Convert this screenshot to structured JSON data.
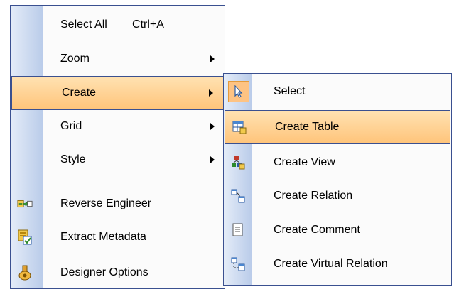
{
  "main_menu": {
    "items": [
      {
        "label": "Select All",
        "shortcut": "Ctrl+A"
      },
      {
        "label": "Zoom"
      },
      {
        "label": "Create"
      },
      {
        "label": "Grid"
      },
      {
        "label": "Style"
      },
      {
        "label": "Reverse Engineer",
        "icon": "reverse-engineer-icon"
      },
      {
        "label": "Extract Metadata",
        "icon": "extract-metadata-icon"
      },
      {
        "label": "Designer Options",
        "icon": "designer-options-icon"
      }
    ]
  },
  "sub_menu": {
    "items": [
      {
        "label": "Select",
        "icon": "cursor-arrow-icon"
      },
      {
        "label": "Create Table",
        "icon": "table-icon"
      },
      {
        "label": "Create View",
        "icon": "view-icon"
      },
      {
        "label": "Create Relation",
        "icon": "relation-icon"
      },
      {
        "label": "Create Comment",
        "icon": "comment-icon"
      },
      {
        "label": "Create Virtual Relation",
        "icon": "virtual-relation-icon"
      }
    ]
  },
  "colors": {
    "border": "#3a5090",
    "highlight_top": "#ffe2b2",
    "highlight_bottom": "#ffc47a",
    "gutter_light": "#e4ecf8",
    "gutter_dark": "#b9cbe9"
  }
}
